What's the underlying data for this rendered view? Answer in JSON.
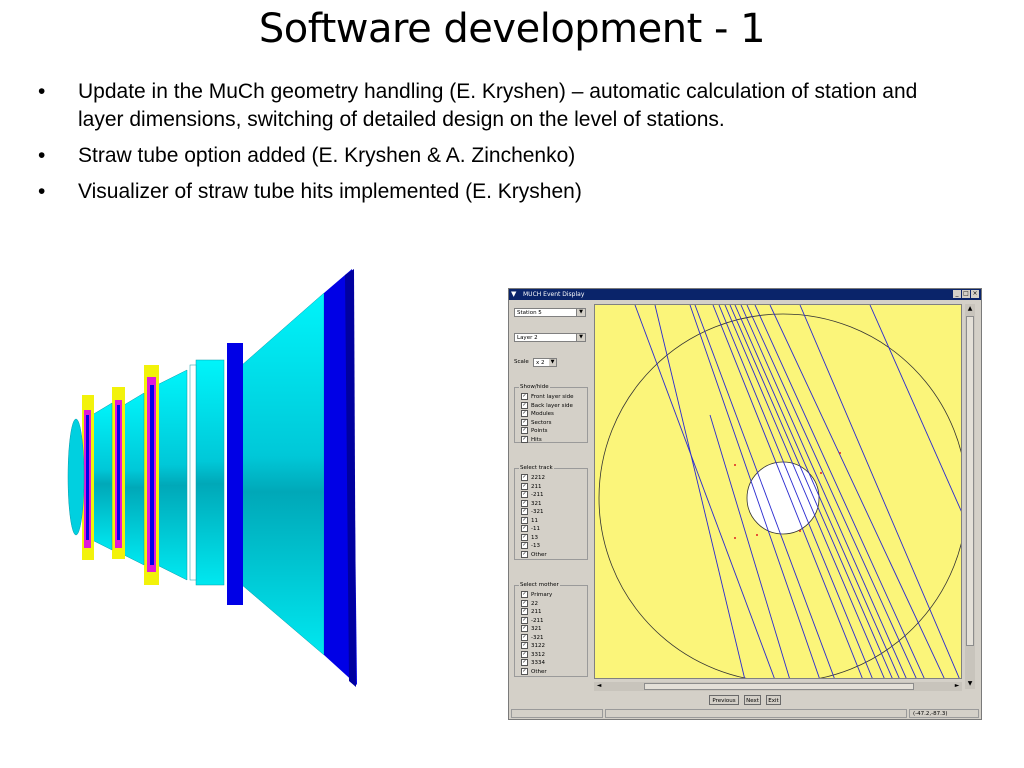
{
  "slide": {
    "title": "Software development - 1",
    "bullets": [
      "Update in the MuCh geometry handling (E. Kryshen) – automatic calculation of station and layer dimensions, switching of detailed design on the level of stations.",
      "Straw tube option added (E. Kryshen & A. Zinchenko)",
      "Visualizer of straw tube hits implemented (E. Kryshen)"
    ],
    "bullet_symbol": "•"
  },
  "window": {
    "title": "MUCH Event Display",
    "menu_glyph": "▼",
    "controls": [
      "_",
      "□",
      "×"
    ],
    "station_select": "Station 5",
    "layer_select": "Layer 2",
    "scale_label": "Scale",
    "scale_value": "x 2",
    "dropdown_glyph": "▼",
    "check_glyph": "✓",
    "showhide": {
      "label": "Show/hide",
      "items": [
        "Front layer side",
        "Back layer side",
        "Modules",
        "Sectors",
        "Points",
        "Hits"
      ]
    },
    "select_track": {
      "label": "Select track",
      "items": [
        "2212",
        "211",
        "-211",
        "321",
        "-321",
        "11",
        "-11",
        "13",
        "-13",
        "Other"
      ]
    },
    "select_mother": {
      "label": "Select mother",
      "items": [
        "Primary",
        "22",
        "211",
        "-211",
        "321",
        "-321",
        "3122",
        "3312",
        "3334",
        "Other"
      ]
    },
    "buttons": {
      "previous": "Previous",
      "next": "Next",
      "exit": "Exit"
    },
    "status_coords": "(-47.2,-87.3)",
    "scroll_arrows": {
      "up": "▲",
      "down": "▼",
      "left": "◄",
      "right": "►"
    },
    "colors": {
      "canvas": "#fbf57a",
      "tracks": "#2a2ad0",
      "titlebar": "#0a246a"
    }
  },
  "render": {
    "colors": {
      "cyan": "#00e8f0",
      "blue": "#0000e6",
      "yellow": "#f2f20a",
      "magenta": "#e01ad8"
    }
  }
}
